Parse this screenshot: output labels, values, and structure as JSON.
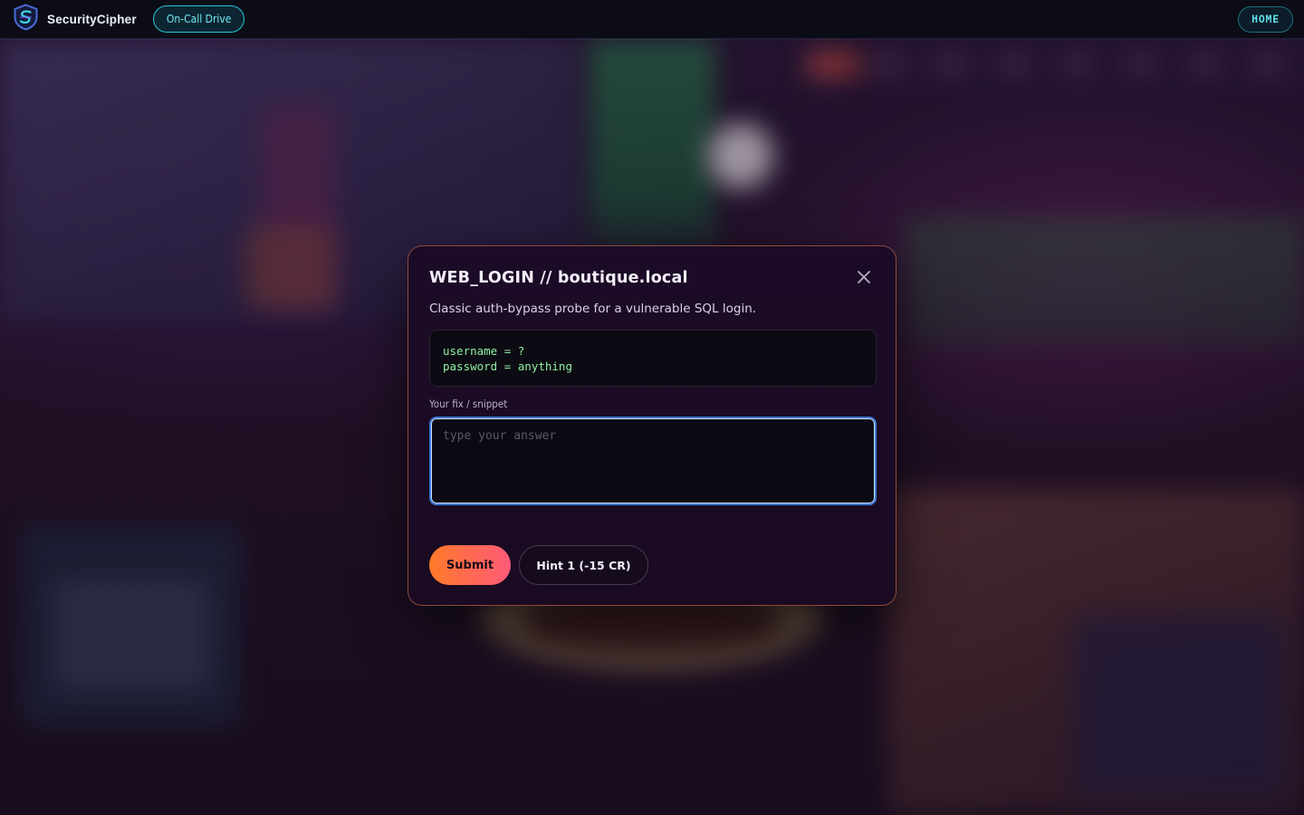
{
  "header": {
    "brand_name": "SecurityCipher",
    "mode_chip": "On-Call Drive",
    "home_label": "HOME"
  },
  "modal": {
    "title": "WEB_LOGIN // boutique.local",
    "description": "Classic auth-bypass probe for a vulnerable SQL login.",
    "code_lines": [
      "username = ?",
      "password = anything"
    ],
    "field_label": "Your fix / snippet",
    "answer_value": "",
    "answer_placeholder": "type your answer",
    "submit_label": "Submit",
    "hint_label": "Hint 1 (-15 CR)"
  },
  "colors": {
    "accent_cyan": "#22c6d9",
    "modal_border": "#8a4a3c",
    "code_green": "#8ff0a4",
    "submit_gradient_start": "#ff7a2a",
    "submit_gradient_end": "#ff5a78",
    "input_focus": "#3d7ad6"
  },
  "icons": {
    "brand": "shield-logo-icon",
    "close": "close-icon"
  }
}
